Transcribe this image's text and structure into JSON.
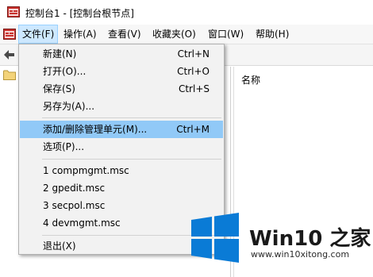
{
  "window": {
    "title": "控制台1 - [控制台根节点]"
  },
  "menubar": {
    "items": [
      {
        "label": "文件(F)",
        "active": true
      },
      {
        "label": "操作(A)"
      },
      {
        "label": "查看(V)"
      },
      {
        "label": "收藏夹(O)"
      },
      {
        "label": "窗口(W)"
      },
      {
        "label": "帮助(H)"
      }
    ]
  },
  "file_menu": {
    "new": {
      "label": "新建(N)",
      "shortcut": "Ctrl+N"
    },
    "open": {
      "label": "打开(O)...",
      "shortcut": "Ctrl+O"
    },
    "save": {
      "label": "保存(S)",
      "shortcut": "Ctrl+S"
    },
    "save_as": {
      "label": "另存为(A)..."
    },
    "add_remove_snapin": {
      "label": "添加/删除管理单元(M)...",
      "shortcut": "Ctrl+M"
    },
    "options": {
      "label": "选项(P)..."
    },
    "recent": [
      {
        "label": "1 compmgmt.msc"
      },
      {
        "label": "2 gpedit.msc"
      },
      {
        "label": "3 secpol.msc"
      },
      {
        "label": "4 devmgmt.msc"
      }
    ],
    "exit": {
      "label": "退出(X)"
    }
  },
  "details": {
    "column_name": "名称"
  },
  "watermark": {
    "brand": "Win10 之家",
    "url": "www.win10xitong.com",
    "logo": "windows-logo"
  },
  "colors": {
    "hover": "#91c9f7",
    "menu_active": "#cde8ff",
    "logo_blue": "#0a7bd6"
  }
}
